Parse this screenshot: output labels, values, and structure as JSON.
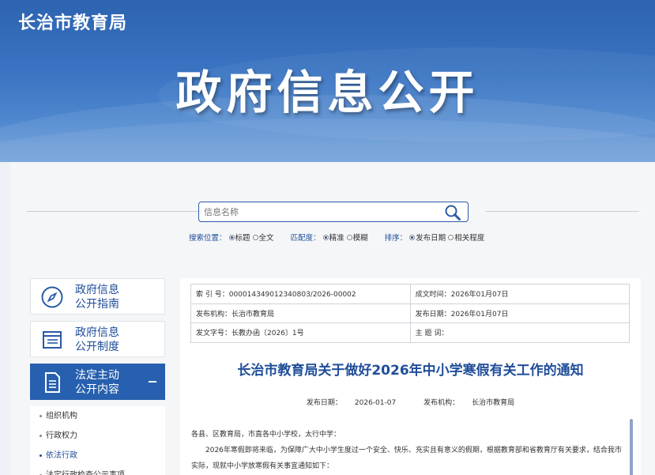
{
  "header": {
    "site_name": "长治市教育局",
    "banner_title": "政府信息公开"
  },
  "search": {
    "placeholder": "信息名称",
    "position_label": "搜索位置：",
    "position_opt1": "标题",
    "position_opt2": "全文",
    "match_label": "匹配度：",
    "match_opt1": "精准",
    "match_opt2": "模糊",
    "sort_label": "排序：",
    "sort_opt1": "发布日期",
    "sort_opt2": "相关程度"
  },
  "sidebar": {
    "cards": [
      {
        "line1": "政府信息",
        "line2": "公开指南"
      },
      {
        "line1": "政府信息",
        "line2": "公开制度"
      },
      {
        "line1": "法定主动",
        "line2": "公开内容"
      }
    ],
    "sub_items": [
      "组织机构",
      "行政权力",
      "依法行政",
      "法定行政检查公示事项"
    ]
  },
  "meta": {
    "index_label": "索 引 号：",
    "index_value": "000014349012340803/2026-00002",
    "created_label": "成文时间：",
    "created_value": "2026年01月07日",
    "org_label": "发布机构：",
    "org_value": "长治市教育局",
    "pub_label": "发布日期：",
    "pub_value": "2026年01月07日",
    "doc_label": "发文字号：",
    "doc_value": "长教办函〔2026〕1号",
    "topic_label": "主  题  词："
  },
  "article": {
    "title": "长治市教育局关于做好2026年中小学寒假有关工作的通知",
    "date_label": "发布日期：",
    "date_value": "2026-01-07",
    "org_label": "发布机构：",
    "org_value": "长治市教育局",
    "salutation": "各县、区教育局，市直各中小学校，太行中学：",
    "para1": "2026年寒假即将来临，为保障广大中小学生度过一个安全、快乐、充实且有意义的假期，根据教育部和省教育厅有关要求，结合我市实际，现就中小学放寒假有关事宜通知如下："
  }
}
